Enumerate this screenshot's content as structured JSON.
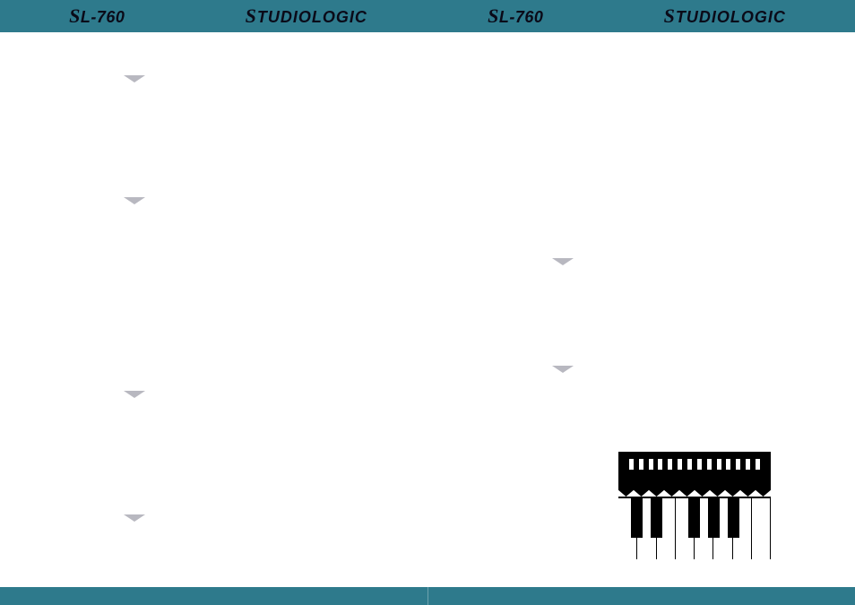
{
  "header": {
    "brand_model_1": "L-760",
    "brand_name_1": "TUDIOLOGIC",
    "brand_model_2": "L-760",
    "brand_name_2": "TUDIOLOGIC",
    "s_prefix": "S"
  },
  "colors": {
    "teal": "#2e7a8c",
    "dark_navy": "#0a0a18",
    "arrow_gray": "#b8b8c0"
  },
  "icons": {
    "arrow_down": "▼"
  }
}
